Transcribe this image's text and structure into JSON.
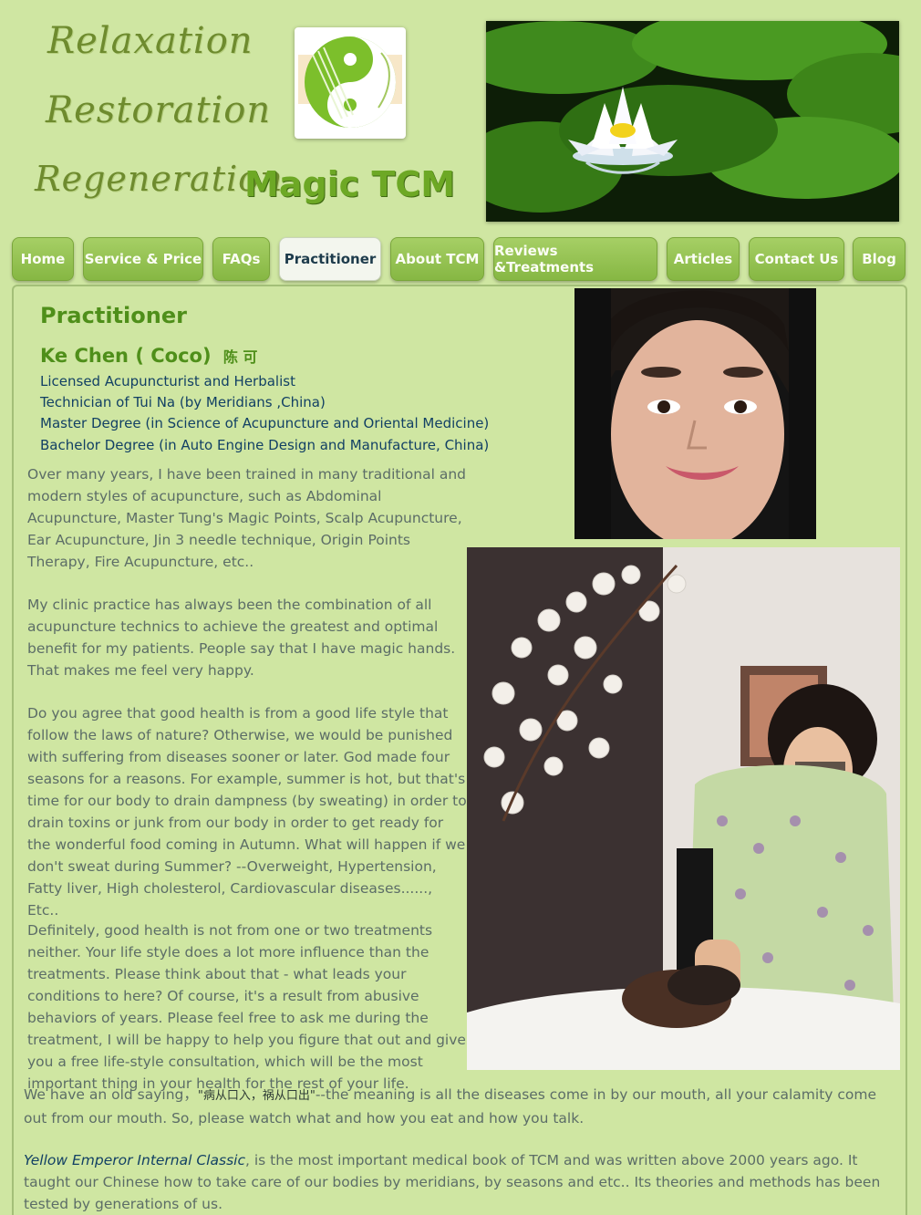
{
  "header": {
    "taglines": [
      "Relaxation",
      "Restoration",
      "Regeneration"
    ],
    "brand": "Magic TCM"
  },
  "nav": {
    "items": [
      {
        "label": "Home"
      },
      {
        "label": "Service & Price"
      },
      {
        "label": "FAQs"
      },
      {
        "label": "Practitioner"
      },
      {
        "label": "About TCM"
      },
      {
        "label": "Reviews &Treatments"
      },
      {
        "label": "Articles"
      },
      {
        "label": "Contact Us"
      },
      {
        "label": "Blog"
      }
    ],
    "active": "Practitioner"
  },
  "page": {
    "title": "Practitioner",
    "name": "Ke Chen ( Coco)",
    "name_chinese": "陈 可",
    "credentials": [
      "Licensed Acupuncturist and Herbalist",
      "Technician of Tui Na (by Meridians ,China)",
      "Master Degree  (in  Science of Acupuncture and Oriental Medicine)",
      "Bachelor Degree (in Auto Engine Design and Manufacture, China)"
    ],
    "paragraphs": [
      "Over many years, I  have been trained in many traditional and modern styles of acupuncture, such as Abdominal Acupuncture, Master Tung's Magic Points, Scalp Acupuncture, Ear Acupuncture, Jin 3 needle technique, Origin Points Therapy, Fire Acupuncture, etc..",
      "My clinic practice has always been  the combination  of  all acupuncture technics to achieve the greatest and optimal benefit for my  patients. People say that I have magic hands. That makes me feel very happy.",
      "Do you agree that good health is from a good life style that follow the laws of  nature? Otherwise, we would be punished with suffering from diseases sooner or later. God made four seasons for a reasons. For example, summer is hot, but that's time for our body to drain dampness (by sweating) in order to drain toxins or junk from our body in order to get ready for the wonderful food coming in Autumn. What will happen if we don't sweat during Summer? --Overweight, Hypertension, Fatty liver, High cholesterol, Cardiovascular diseases......, Etc..",
      "Definitely, good health is not from one or two treatments neither. Your life style does a lot more influence than the treatments. Please think about that - what leads your conditions to here? Of course, it's a result from abusive behaviors of years. Please feel free to ask me during the treatment, I will be happy to help you figure that out and give you a free life-style consultation, which will be the most important thing in your health for the rest of your life."
    ],
    "saying_before": "We have an old saying，",
    "saying_chinese": "\"病从口入，祸从口出\"",
    "saying_after": "--the meaning is all the diseases come in by our mouth, all your calamity  come out from our mouth. So, please watch what and how you eat and how you talk.",
    "classic_title": "Yellow Emperor Internal Classic",
    "classic_text": ", is the most important medical book of TCM and was written above 2000 years ago. It taught our Chinese how to take care of our bodies by meridians, by seasons and etc.. Its theories and methods has been tested by generations of us."
  },
  "colors": {
    "background": "#cfe6a2",
    "nav_green": "#92c04f",
    "heading_green": "#4f8f1a",
    "credential_blue": "#124064",
    "body_text": "#5c6d67"
  }
}
